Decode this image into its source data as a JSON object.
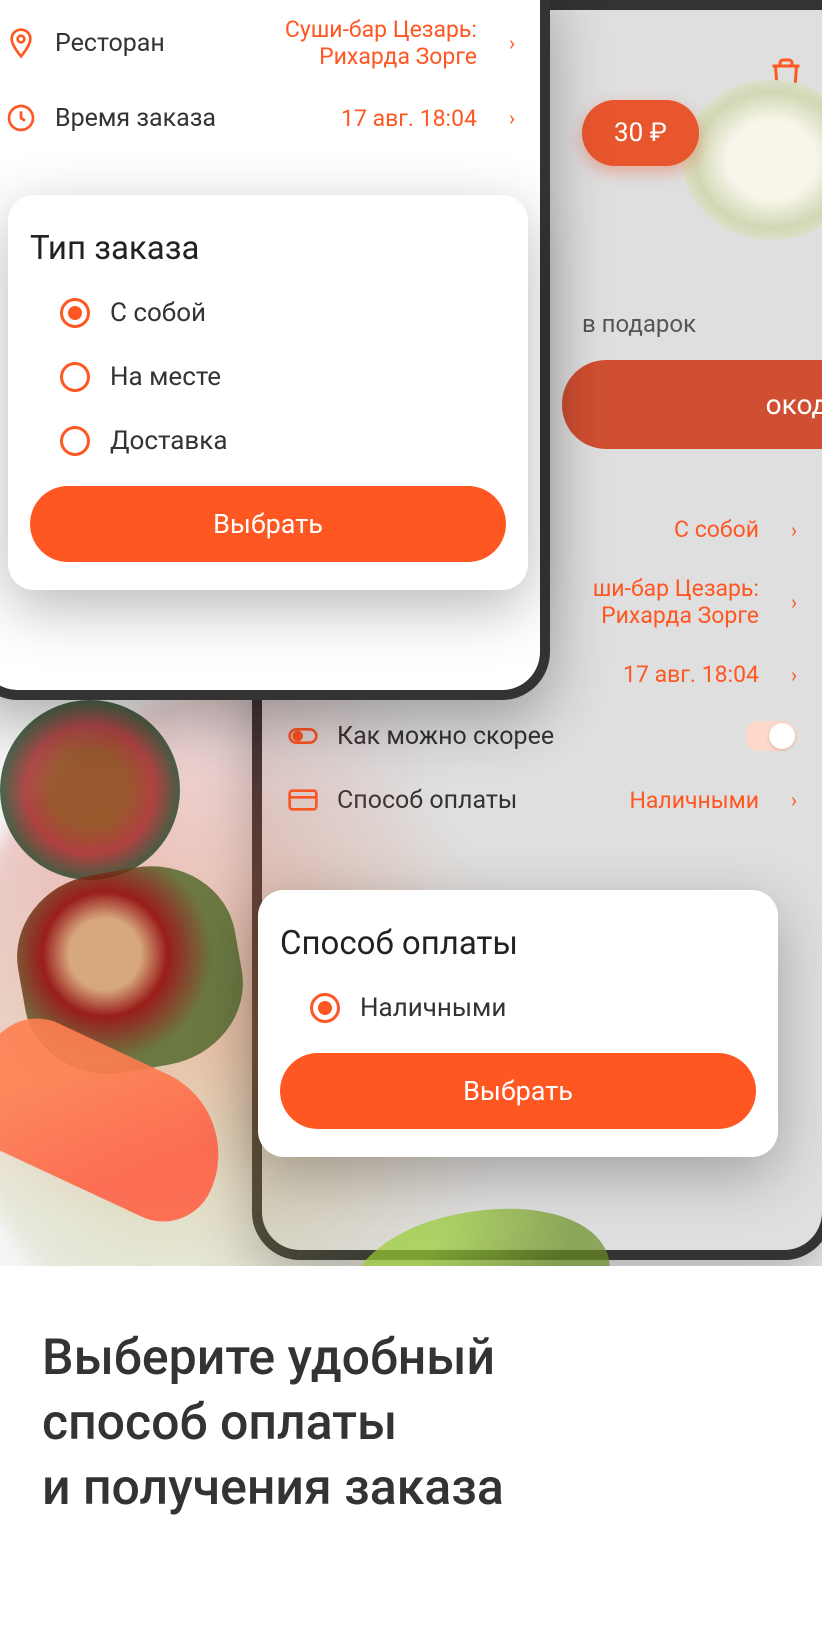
{
  "phone1": {
    "rows": {
      "restaurant": {
        "label": "Ресторан",
        "value": "Суши-бар Цезарь: Рихарда Зорге"
      },
      "orderTime": {
        "label": "Время заказа",
        "value": "17 авг. 18:04"
      }
    },
    "modal": {
      "title": "Тип заказа",
      "options": [
        "С собой",
        "На месте",
        "Доставка"
      ],
      "selectedIndex": 0,
      "button": "Выбрать"
    }
  },
  "phone2": {
    "pricePill": "30 ₽",
    "giftText": "в подарок",
    "promoPill": "окод",
    "rows": {
      "orderType": {
        "value": "С собой"
      },
      "restaurant": {
        "valueLine1": "ши-бар Цезарь:",
        "valueLine2": "Рихарда Зорге"
      },
      "orderTime": {
        "value": "17 авг. 18:04"
      },
      "asap": {
        "label": "Как можно скорее"
      },
      "payment": {
        "label": "Способ оплаты",
        "value": "Наличными"
      }
    },
    "modal": {
      "title": "Способ оплаты",
      "option": "Наличными",
      "button": "Выбрать"
    }
  },
  "marketing": {
    "line1": "Выберите удобный",
    "line2": "способ оплаты",
    "line3": "и получения заказа"
  }
}
